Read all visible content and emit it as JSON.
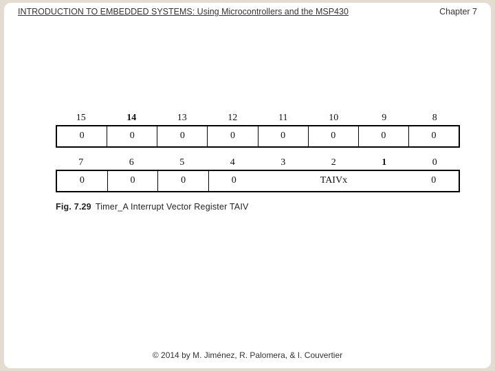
{
  "header": {
    "title": "INTRODUCTION TO EMBEDDED SYSTEMS: Using Microcontrollers and the MSP430",
    "chapter": "Chapter 7"
  },
  "footer": {
    "copyright": "© 2014 by M. Jiménez, R. Palomera, & I. Couvertier"
  },
  "figure": {
    "upper_bits": [
      "15",
      "14",
      "13",
      "12",
      "11",
      "10",
      "9",
      "8"
    ],
    "upper_values": [
      "0",
      "0",
      "0",
      "0",
      "0",
      "0",
      "0",
      "0"
    ],
    "lower_bits": [
      "7",
      "6",
      "5",
      "4",
      "3",
      "2",
      "1",
      "0"
    ],
    "lower_values_left": [
      "0",
      "0",
      "0",
      "0"
    ],
    "taivx_label": "TAIVx",
    "lower_value_right": "0",
    "caption_no": "Fig. 7.29",
    "caption_text": "Timer_A Interrupt Vector Register TAIV"
  },
  "bold_bit_indices": {
    "upper": [
      1
    ],
    "lower": [
      6
    ]
  }
}
